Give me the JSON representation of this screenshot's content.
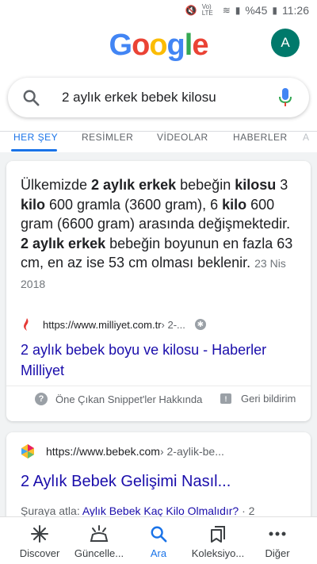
{
  "status_bar": {
    "battery": "%45",
    "time": "11:26",
    "network": "Vo) LTE"
  },
  "logo": {
    "letters": [
      "G",
      "o",
      "o",
      "g",
      "l",
      "e"
    ],
    "colors": [
      "#4285F4",
      "#EA4335",
      "#FBBC05",
      "#4285F4",
      "#34A853",
      "#EA4335"
    ]
  },
  "account": {
    "initial": "A",
    "color": "#00796b"
  },
  "search": {
    "query": "2 aylık erkek bebek kilosu"
  },
  "tabs": [
    "HER ŞEY",
    "RESİMLER",
    "VİDEOLAR",
    "HABERLER",
    "A"
  ],
  "featured_snippet": {
    "segments": [
      {
        "t": "Ülkemizde ",
        "b": false
      },
      {
        "t": "2 aylık erkek",
        "b": true
      },
      {
        "t": " bebeğin ",
        "b": false
      },
      {
        "t": "kilosu",
        "b": true
      },
      {
        "t": " 3 ",
        "b": false
      },
      {
        "t": "kilo",
        "b": true
      },
      {
        "t": " 600 gramla (3600 gram), 6 ",
        "b": false
      },
      {
        "t": "kilo",
        "b": true
      },
      {
        "t": " 600 gram (6600 gram) arasında değişmektedir. ",
        "b": false
      },
      {
        "t": "2 aylık erkek",
        "b": true
      },
      {
        "t": " bebeğin boyunun en fazla 63 cm, en az ise 53 cm olması beklenir. ",
        "b": false
      }
    ],
    "date": "23 Nis 2018",
    "source_domain": "https://www.milliyet.com.tr",
    "source_path": " › 2-...",
    "title": "2 aylık bebek boyu ve kilosu - Haberler Milliyet",
    "about_label": "Öne Çıkan Snippet'ler Hakkında",
    "feedback_label": "Geri bildirim"
  },
  "result2": {
    "source_domain": "https://www.bebek.com",
    "source_path": " › 2-aylik-be...",
    "title": "2 Aylık Bebek Gelişimi Nasıl...",
    "jump_prefix": "Şuraya atla: ",
    "jump_link": "Aylık Bebek Kaç Kilo Olmalıdır?",
    "jump_suffix": " · 2"
  },
  "bottom_nav": [
    {
      "label": "Discover",
      "icon": "asterisk-icon"
    },
    {
      "label": "Güncelle...",
      "icon": "updates-icon"
    },
    {
      "label": "Ara",
      "icon": "search-icon"
    },
    {
      "label": "Koleksiyo...",
      "icon": "collections-icon"
    },
    {
      "label": "Diğer",
      "icon": "more-icon"
    }
  ]
}
